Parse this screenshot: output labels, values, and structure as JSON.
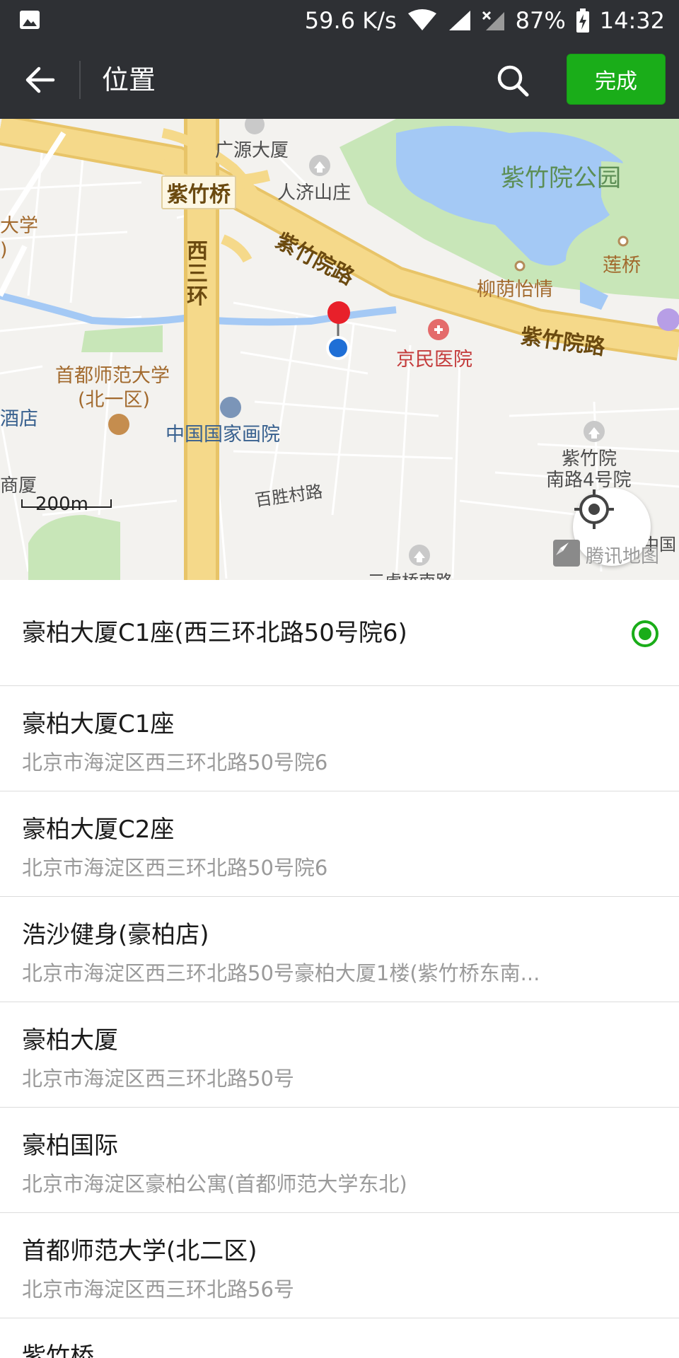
{
  "status_bar": {
    "speed": "59.6 K/s",
    "battery": "87%",
    "time": "14:32"
  },
  "header": {
    "title": "位置",
    "done_label": "完成"
  },
  "map": {
    "labels": {
      "guangyuan": "广源大厦",
      "zizhuqiao": "紫竹桥",
      "renjishanzhuang": "人济山庄",
      "park": "紫竹院公园",
      "daxue_left": "大学",
      "paren": ")",
      "xisanhuan": "西三环",
      "zizhuyuanlu_1": "紫竹院路",
      "zizhuyuanlu_2": "紫竹院路",
      "lianqiao": "莲桥",
      "liuyinyiqing": "柳荫怡情",
      "jingmin": "京民医院",
      "shoudu_1": "首都师范大学",
      "shoudu_2": "(北一区)",
      "jiudian": "酒店",
      "huayuan": "中国国家画院",
      "zizhuyuan_s1": "紫竹院",
      "zizhuyuan_s2": "南路4号院",
      "shangsha": "商厦",
      "baishengcun": "百胜村路",
      "zhongguo": "中国",
      "sanhu": "三虎桥南路",
      "logo": "腾讯地图"
    },
    "scale": "200m"
  },
  "selected": {
    "name": "豪柏大厦C1座(西三环北路50号院6)"
  },
  "items": [
    {
      "name": "豪柏大厦C1座",
      "address": "北京市海淀区西三环北路50号院6"
    },
    {
      "name": "豪柏大厦C2座",
      "address": "北京市海淀区西三环北路50号院6"
    },
    {
      "name": "浩沙健身(豪柏店)",
      "address": "北京市海淀区西三环北路50号豪柏大厦1楼(紫竹桥东南..."
    },
    {
      "name": "豪柏大厦",
      "address": "北京市海淀区西三环北路50号"
    },
    {
      "name": "豪柏国际",
      "address": "北京市海淀区豪柏公寓(首都师范大学东北)"
    },
    {
      "name": "首都师范大学(北二区)",
      "address": "北京市海淀区西三环北路56号"
    },
    {
      "name": "紫竹桥",
      "address": ""
    }
  ],
  "colors": {
    "accent": "#1aad19",
    "header_bg": "#2e3034",
    "road_yellow": "#f5d98a",
    "park_green": "#c8e6b8",
    "water_blue": "#a4c9f5"
  }
}
